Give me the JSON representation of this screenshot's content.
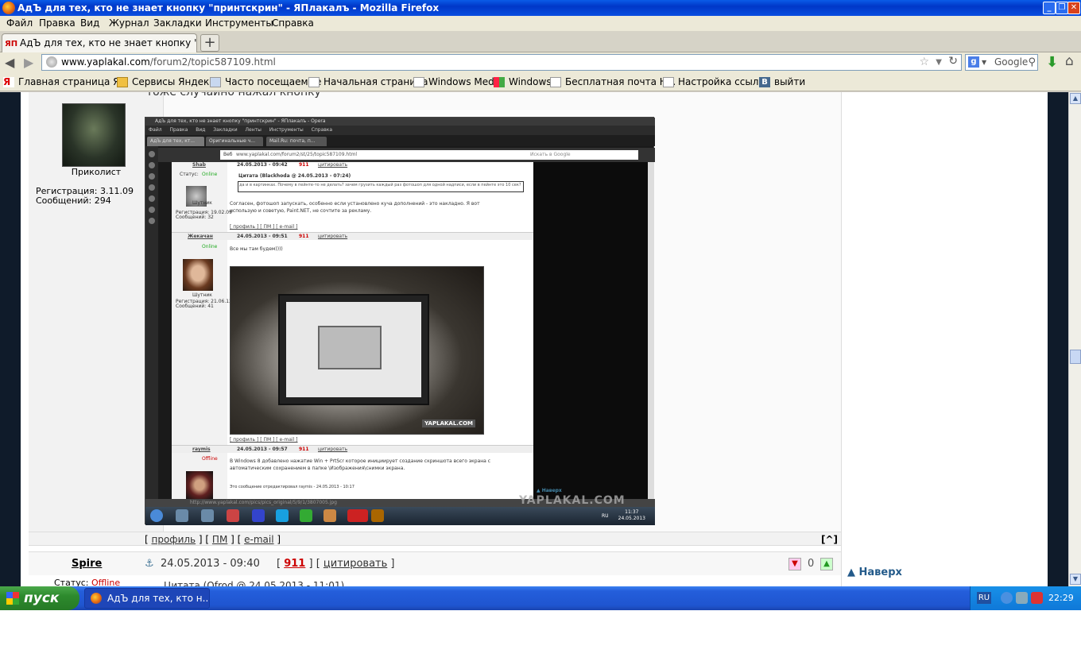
{
  "window": {
    "title": "АдЪ для тех, кто не знает кнопку \"принтскрин\" - ЯПлакалъ - Mozilla Firefox"
  },
  "menu": [
    "Файл",
    "Правка",
    "Вид",
    "Журнал",
    "Закладки",
    "Инструменты",
    "Справка"
  ],
  "tab": {
    "label": "АдЪ для тех, кто не знает кнопку \"принт...",
    "favicon": "ЯП",
    "new_tab": "+"
  },
  "nav": {
    "back": "◀",
    "forward": "▶",
    "url_host": "www.yaplakal.com",
    "url_path": "/forum2/topic587109.html",
    "search_engine": "Google"
  },
  "bookmarks": [
    "Главная страница Я...",
    "Сервисы Яндекса",
    "Часто посещаемые",
    "Начальная страница",
    "Windows Media",
    "Windows",
    "Бесплатная почта Н...",
    "Настройка ссылок",
    "выйти"
  ],
  "post1": {
    "top_text": "тоже случайно нажал кнопку",
    "nick": "Приколист",
    "reg": "Регистрация: 3.11.09",
    "msgs": "Сообщений: 294",
    "links": [
      "профиль",
      "ПМ",
      "e-mail"
    ],
    "to_top": "[^]"
  },
  "screenshot": {
    "title": "АдЪ для тех, кто не знает кнопку \"принтскрин\" - ЯПлакалъ - Opera",
    "menu": "Файл Правка Вид Закладки Ленты Инструменты Справка",
    "tabs": [
      "АдЪ для тех, кт...",
      "Оригинальные ч...",
      "Mail.Ru: почта, п..."
    ],
    "url": "www.yaplakal.com/forum2/st/25/topic587109.html",
    "url_prefix": "Веб",
    "search_placeholder": "Искать в Google",
    "p1_nick": "Shab",
    "p1_date": "24.05.2013 - 09:42",
    "p1_status_label": "Статус:",
    "p1_status": "Online",
    "p1_rank": "Шутник",
    "p1_reg": "Регистрация: 19.02.09",
    "p1_msgs": "Сообщений: 32",
    "quote_head": "Цитата (Blackhoda @ 24.05.2013 - 07:24)",
    "quote_text": "да и в картинках. Почему в пейнте-то не делать? зачем грузить каждый раз фотошоп для одной надписи, если в пейнте это 10 сек?",
    "p1_text": "Согласен, фотошоп запускать, особенно если установлено куча дополнений - это накладно. Я вот использую и советую, Paint.NET, не сочтите за рекламу.",
    "links_line": "[ профиль ] [ ПМ ] [ e-mail ]",
    "p2_nick": "Жекачан",
    "p2_date": "24.05.2013 - 09:51",
    "p2_status": "Online",
    "p2_rank": "Шутник",
    "p2_reg": "Регистрация: 21.06.12",
    "p2_msgs": "Сообщений: 41",
    "p2_text": "Все мы там будем))))",
    "photo_watermark": "YAPLAKAL.COM",
    "p3_nick": "raymis",
    "p3_date": "24.05.2013 - 09:57",
    "p3_status": "Offline",
    "p3_text": "В Windows 8 добавлено нажатие Win + PrtScr которое инициирует создание скриншота всего экрана с автоматическим сохранением в папке \\Изображения\\снимки экрана.",
    "p3_edit": "Это сообщение отредактировал raymis - 24.05.2013 - 10:17",
    "rep_num": "911",
    "quote_btn": "цитировать",
    "navtop": "▲ Наверх",
    "watermark": "YAPLAKAL.COM",
    "status_url": "http://www.yaplakal.com/pics/pics_original/5/9/1/3807005.jpg",
    "tray_lang": "RU",
    "clock_time": "11:37",
    "clock_date": "24.05.2013"
  },
  "post2": {
    "nick": "Spire",
    "date": "24.05.2013 - 09:40",
    "rep_open": "[",
    "rep": "911",
    "quote_btn": "цитировать",
    "rating": "0",
    "status_label": "Статус:",
    "status": "Offline",
    "quote_start": "Цитата (Ofrod @ 24.05.2013 - 11:01)"
  },
  "sidebar": {
    "to_top": "▲ Наверх"
  },
  "taskbar": {
    "start": "пуск",
    "app": "АдЪ для тех, кто н...",
    "lang": "RU",
    "time": "22:29"
  },
  "colors": {
    "taskbar": "#245edb",
    "start": "#2d8a2d",
    "rep": "#cc0000",
    "online": "#22aa22"
  }
}
